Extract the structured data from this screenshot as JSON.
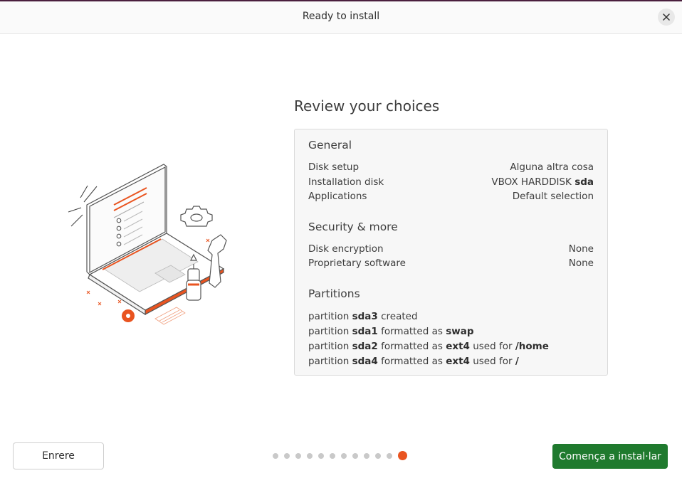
{
  "window": {
    "title": "Ready to install",
    "close_icon": "close-icon"
  },
  "heading": "Review your choices",
  "general": {
    "title": "General",
    "rows": [
      {
        "label": "Disk setup",
        "value": "Alguna altra cosa"
      },
      {
        "label": "Installation disk",
        "value_prefix": "VBOX HARDDISK",
        "value_bold": "sda"
      },
      {
        "label": "Applications",
        "value": "Default selection"
      }
    ]
  },
  "security": {
    "title": "Security & more",
    "rows": [
      {
        "label": "Disk encryption",
        "value": "None"
      },
      {
        "label": "Proprietary software",
        "value": "None"
      }
    ]
  },
  "partitions": {
    "title": "Partitions",
    "lines": [
      {
        "p1": "partition",
        "b1": "sda3",
        "p2": "created"
      },
      {
        "p1": "partition",
        "b1": "sda1",
        "p2": "formatted as",
        "b2": "swap"
      },
      {
        "p1": "partition",
        "b1": "sda2",
        "p2": "formatted as",
        "b2": "ext4",
        "p3": "used for",
        "b3": "/home"
      },
      {
        "p1": "partition",
        "b1": "sda4",
        "p2": "formatted as",
        "b2": "ext4",
        "p3": "used for",
        "b3": "/"
      }
    ]
  },
  "footer": {
    "back_label": "Enrere",
    "install_label": "Comença a instal·lar",
    "steps_total": 12,
    "current_step": 12
  },
  "colors": {
    "accent": "#e95420",
    "install_button": "#1f7a2e"
  }
}
